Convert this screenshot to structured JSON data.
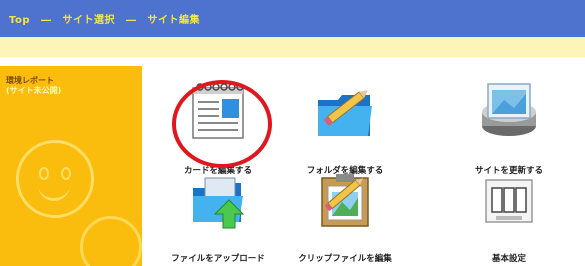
{
  "breadcrumb": {
    "items": [
      "Top",
      "サイト選択",
      "サイト編集"
    ],
    "separator": "―"
  },
  "sidebar": {
    "title": "環境レポート",
    "subtitle": "(サイト未公開)"
  },
  "actions": [
    {
      "id": "edit-card",
      "label": "カードを編集する",
      "icon": "notepad-edit-icon"
    },
    {
      "id": "edit-folder",
      "label": "フォルダを編集する",
      "icon": "folder-edit-icon"
    },
    {
      "id": "update-site",
      "label": "サイトを更新する",
      "icon": "site-update-icon"
    },
    {
      "id": "upload-file",
      "label": "ファイルをアップロード",
      "icon": "folder-upload-icon"
    },
    {
      "id": "edit-clip",
      "label": "クリップファイルを編集",
      "icon": "clipboard-edit-icon"
    },
    {
      "id": "basic-settings",
      "label": "基本設定",
      "icon": "settings-icon"
    }
  ],
  "colors": {
    "header": "#4d73cf",
    "breadcrumb": "#f6e24b",
    "subbar": "#fdf4b8",
    "sidebar": "#fbbd0d",
    "highlight": "#e0171f"
  }
}
